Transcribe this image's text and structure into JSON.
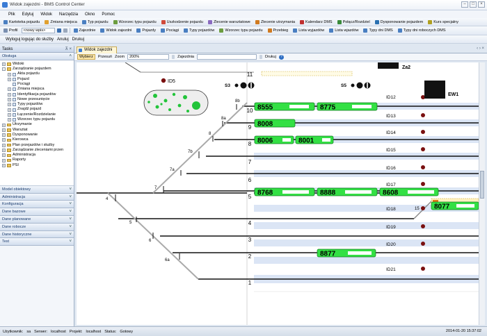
{
  "window": {
    "title": "Widok zajezdni - BMS Control Center"
  },
  "menu": [
    "Plik",
    "Edytuj",
    "Widok",
    "Narzędzia",
    "Okno",
    "Pomoc"
  ],
  "toolbar1": [
    {
      "label": "Kartoteka pojazdu",
      "icon": "vehicle-card-icon",
      "color": "#4a7fc1"
    },
    {
      "label": "Zmiana miejsca",
      "icon": "move-icon",
      "color": "#e0a030"
    },
    {
      "label": "Typ pojazdu",
      "icon": "vehicle-type-icon",
      "color": "#4a7fc1"
    },
    {
      "label": "Wzorzec typu pojazdu",
      "icon": "template-icon",
      "color": "#6c9d40"
    },
    {
      "label": "Uszkodzenie pojazdu",
      "icon": "damage-icon",
      "color": "#d04a3a"
    },
    {
      "label": "Zlecenie warsztatowe",
      "icon": "workshop-icon",
      "color": "#8a6bbf"
    },
    {
      "label": "Zlecenie utrzymania",
      "icon": "maintenance-icon",
      "color": "#d07a20"
    },
    {
      "label": "Kalendarz DMS",
      "icon": "calendar-icon",
      "color": "#c03030"
    },
    {
      "label": "Połącz/Rozdziel",
      "icon": "link-icon",
      "color": "#3a8a3a"
    },
    {
      "label": "Dysponowanie pojazdem",
      "icon": "dispatch-icon",
      "color": "#2a70b0"
    },
    {
      "label": "Kurs specjalny",
      "icon": "special-course-icon",
      "color": "#b0a020"
    }
  ],
  "toolbar2": {
    "profile_label": "Profil",
    "profile_value": "<nowy wpis>",
    "buttons": [
      {
        "label": "Zajezdnie",
        "icon": "depot-icon",
        "color": "#4a7fc1"
      },
      {
        "label": "Widok zajezdni",
        "icon": "depot-view-icon",
        "color": "#4a7fc1"
      },
      {
        "label": "Pojazdy",
        "icon": "vehicles-icon",
        "color": "#4a7fc1"
      },
      {
        "label": "Pociągi",
        "icon": "trains-icon",
        "color": "#4a7fc1"
      },
      {
        "label": "Typy pojazdów",
        "icon": "vehicle-types-icon",
        "color": "#4a7fc1"
      },
      {
        "label": "Wzorzec typu pojazdu",
        "icon": "template-icon",
        "color": "#6c9d40"
      },
      {
        "label": "Przebieg",
        "icon": "mileage-icon",
        "color": "#d07a20"
      },
      {
        "label": "Lista wyjazdów",
        "icon": "departures-icon",
        "color": "#4a7fc1"
      },
      {
        "label": "Lista wjazdów",
        "icon": "arrivals-icon",
        "color": "#4a7fc1"
      },
      {
        "label": "Typy dni DMS",
        "icon": "day-types-icon",
        "color": "#4a7fc1"
      },
      {
        "label": "Typy dni roboczych DMS",
        "icon": "workday-types-icon",
        "color": "#4a7fc1"
      }
    ]
  },
  "toolbar3": [
    "Wyloguj logując do służby",
    "Anuluj",
    "Drukuj"
  ],
  "left_panel": {
    "title": "Tasks",
    "section": "Obsługa",
    "tree": [
      {
        "label": "Widoki",
        "depth": 1,
        "kind": "folder",
        "pm": "+"
      },
      {
        "label": "Zarządzanie pojazdem",
        "depth": 1,
        "kind": "folder",
        "pm": "-"
      },
      {
        "label": "Akta pojazdu",
        "depth": 2,
        "kind": "doc",
        "pm": "+"
      },
      {
        "label": "Pojazd",
        "depth": 2,
        "kind": "doc",
        "pm": "+"
      },
      {
        "label": "Pociągi",
        "depth": 2,
        "kind": "doc",
        "pm": ""
      },
      {
        "label": "Zmiana miejsca",
        "depth": 2,
        "kind": "doc",
        "pm": "+"
      },
      {
        "label": "Identyfikacja pojazdów",
        "depth": 2,
        "kind": "doc",
        "pm": "+"
      },
      {
        "label": "Nowe przesunięcie",
        "depth": 2,
        "kind": "doc",
        "pm": "+"
      },
      {
        "label": "Typy pojazdów",
        "depth": 2,
        "kind": "doc",
        "pm": "+"
      },
      {
        "label": "Znajdź pojazd",
        "depth": 2,
        "kind": "doc",
        "pm": "+"
      },
      {
        "label": "Łączenie/Rozdzielanie",
        "depth": 2,
        "kind": "doc",
        "pm": "+"
      },
      {
        "label": "Wzorzec typu pojazdu",
        "depth": 2,
        "kind": "doc",
        "pm": "+"
      },
      {
        "label": "Utrzymanie",
        "depth": 1,
        "kind": "folder",
        "pm": "+"
      },
      {
        "label": "Warsztat",
        "depth": 1,
        "kind": "folder",
        "pm": "+"
      },
      {
        "label": "Dysponowanie",
        "depth": 1,
        "kind": "folder",
        "pm": "+"
      },
      {
        "label": "Kierowca",
        "depth": 1,
        "kind": "folder",
        "pm": "+"
      },
      {
        "label": "Plan przejazdów i służby",
        "depth": 1,
        "kind": "folder",
        "pm": "+"
      },
      {
        "label": "Zarządzanie zleceniami przen",
        "depth": 1,
        "kind": "folder",
        "pm": "+"
      },
      {
        "label": "Administracja",
        "depth": 1,
        "kind": "folder",
        "pm": "+"
      },
      {
        "label": "Raporty",
        "depth": 1,
        "kind": "folder",
        "pm": "+"
      },
      {
        "label": "PSI",
        "depth": 1,
        "kind": "folder",
        "pm": "+"
      }
    ],
    "sections": [
      "Model obiektowy",
      "Administracja",
      "Konfiguracja",
      "Dane bazowe",
      "Dane planowane",
      "Dane robocze",
      "Dane historyczne",
      "Test"
    ]
  },
  "tab": {
    "label": "Widok zajezdni"
  },
  "viewbar": {
    "select_label": "Wybierz",
    "move_label": "Przesuń",
    "zoom_label": "Zoom",
    "zoom_value": "200%",
    "depot_label": "Zajezdnia",
    "depot_value": "",
    "print_label": "Drukuj",
    "help_icon": "help-icon"
  },
  "depot": {
    "tracks": [
      {
        "num": "11"
      },
      {
        "num": "10"
      },
      {
        "num": "9"
      },
      {
        "num": "8"
      },
      {
        "num": "7"
      },
      {
        "num": "6"
      },
      {
        "num": "5"
      },
      {
        "num": "4"
      },
      {
        "num": "3"
      },
      {
        "num": "2"
      },
      {
        "num": "1"
      }
    ],
    "switches": [
      "8b",
      "8a",
      "8",
      "7b",
      "7a",
      "7",
      "4",
      "5",
      "6",
      "6a",
      "15"
    ],
    "ids": [
      "ID12",
      "ID13",
      "ID14",
      "ID15",
      "ID16",
      "ID17",
      "ID18",
      "ID19",
      "ID20",
      "ID21"
    ],
    "labels": {
      "id5": "ID5",
      "s3": "S3",
      "s5": "S5",
      "za2": "Za2",
      "ew1": "EW1"
    },
    "vehicles": [
      "8555",
      "8775",
      "8008",
      "8006",
      "8001",
      "8768",
      "8888",
      "8608",
      "8877",
      "8077"
    ]
  },
  "status": {
    "user_label": "Użytkownik:",
    "user": "sa",
    "server_label": "Serwer:",
    "server": "localhost",
    "project_label": "Projekt:",
    "project": "localhost",
    "status_label": "Status:",
    "status": "Gotowy",
    "clock": "2014-01-20 15:37:02"
  }
}
